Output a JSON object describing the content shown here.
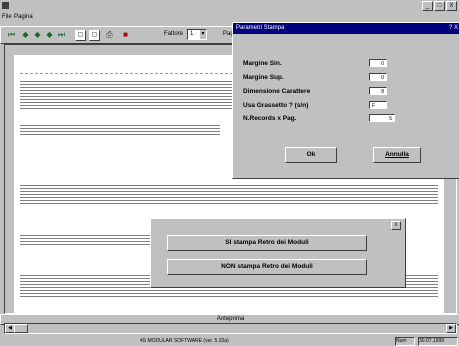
{
  "window": {
    "controls": [
      "_",
      "□",
      "X"
    ]
  },
  "menu": {
    "items": [
      "File",
      "Pagina"
    ]
  },
  "toolbar": {
    "font_label": "Fattore",
    "font_value": "1",
    "page_label": "Pag"
  },
  "param_dialog": {
    "title": "Parametri Stampa",
    "title_controls": "? X",
    "fields": [
      {
        "label": "Margine Sin.",
        "value": "0"
      },
      {
        "label": "Margine Sup.",
        "value": "0"
      },
      {
        "label": "Dimensione Carattere",
        "value": "8"
      },
      {
        "label": "Usa Grassetto ? (s/n)",
        "value": "F"
      },
      {
        "label": "N.Records x Pag.",
        "value": "5"
      }
    ],
    "ok_label": "Ok",
    "cancel_label": "Annulla"
  },
  "retro_dialog": {
    "close": "X",
    "yes_label": "SI stampa Retro dei Moduli",
    "no_label": "NON stampa Retro dei Moduli"
  },
  "preview_label": "Anteprima",
  "status": {
    "center": "4S MODULAR SOFTWARE   (ver. 5.32a)",
    "num": "Num",
    "date": "30.07.1999"
  }
}
